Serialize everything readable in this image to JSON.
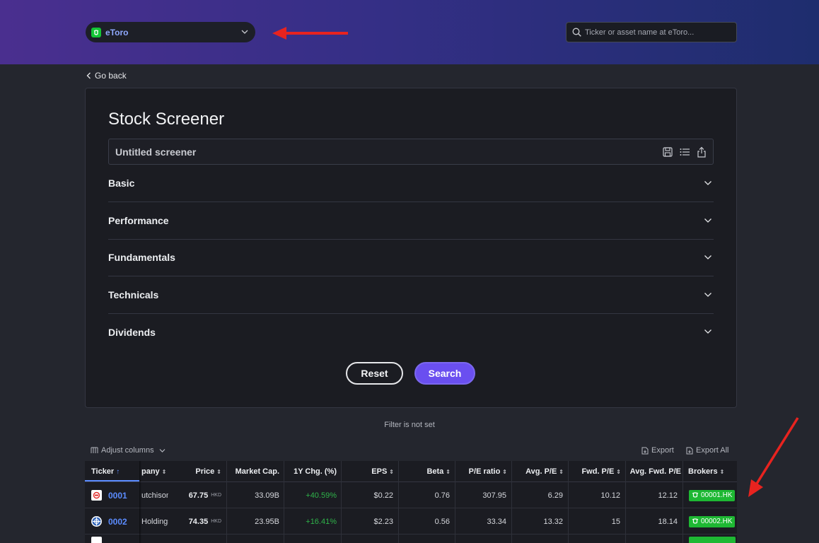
{
  "header": {
    "broker_select": {
      "label": "eToro",
      "icon": "etoro-logo"
    },
    "search": {
      "placeholder": "Ticker or asset name at eToro..."
    },
    "accent_arrow_color": "#e8231f"
  },
  "nav": {
    "go_back": "Go back"
  },
  "screener": {
    "title": "Stock Screener",
    "name_placeholder": "Untitled screener",
    "icons": [
      "save-icon",
      "list-icon",
      "share-icon"
    ],
    "sections": [
      "Basic",
      "Performance",
      "Fundamentals",
      "Technicals",
      "Dividends"
    ],
    "reset_label": "Reset",
    "search_label": "Search",
    "search_color": "#6a4ff0"
  },
  "results": {
    "filter_note": "Filter is not set",
    "adjust_columns": "Adjust columns",
    "export": "Export",
    "export_all": "Export All",
    "columns": [
      "Ticker",
      "pany",
      "Price",
      "Market Cap.",
      "1Y Chg. (%)",
      "EPS",
      "Beta",
      "P/E ratio",
      "Avg. P/E",
      "Fwd. P/E",
      "Avg. Fwd. P/E",
      "Brokers"
    ],
    "rows": [
      {
        "ticker": "0001",
        "company": "utchison I",
        "price": "67.75",
        "currency": "HKD",
        "market_cap": "33.09B",
        "chg_1y": "+40.59%",
        "eps": "$0.22",
        "beta": "0.76",
        "pe": "307.95",
        "avg_pe": "6.29",
        "fwd_pe": "10.12",
        "avg_fwd_pe": "12.12",
        "broker": "00001.HK"
      },
      {
        "ticker": "0002",
        "company": "Holdings",
        "price": "74.35",
        "currency": "HKD",
        "market_cap": "23.95B",
        "chg_1y": "+16.41%",
        "eps": "$2.23",
        "beta": "0.56",
        "pe": "33.34",
        "avg_pe": "13.32",
        "fwd_pe": "15",
        "avg_fwd_pe": "18.14",
        "broker": "00002.HK"
      }
    ]
  }
}
